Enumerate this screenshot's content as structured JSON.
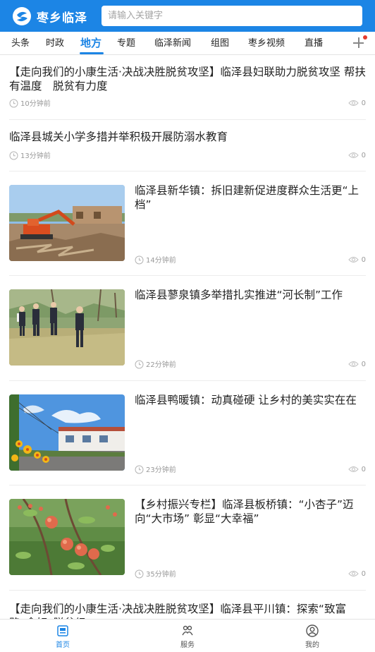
{
  "header": {
    "logo_text": "枣乡临泽",
    "search_placeholder": "请输入关键字",
    "brand_color": "#1c85e5"
  },
  "tabs": [
    {
      "label": "头条"
    },
    {
      "label": "时政"
    },
    {
      "label": "地方",
      "active": true
    },
    {
      "label": "专题"
    },
    {
      "label": "临泽新闻"
    },
    {
      "label": "组图"
    },
    {
      "label": "枣乡视频"
    },
    {
      "label": "直播"
    }
  ],
  "feed": [
    {
      "title": "【走向我们的小康生活·决战决胜脱贫攻坚】临泽县妇联助力脱贫攻坚 帮扶有温度　脱贫有力度",
      "time": "10分钟前",
      "views": "0"
    },
    {
      "title": "临泽县城关小学多措并举积极开展防溺水教育",
      "time": "13分钟前",
      "views": "0"
    },
    {
      "title": "临泽县新华镇：拆旧建新促进度群众生活更“上档”",
      "time": "14分钟前",
      "views": "0",
      "image": "excavator-demolition-photo"
    },
    {
      "title": "临泽县蓼泉镇多举措扎实推进“河长制”工作",
      "time": "22分钟前",
      "views": "0",
      "image": "officials-walking-field-photo"
    },
    {
      "title": "临泽县鸭暖镇：动真碰硬 让乡村的美实实在在",
      "time": "23分钟前",
      "views": "0",
      "image": "village-street-flowers-photo"
    },
    {
      "title": "【乡村振兴专栏】临泽县板桥镇：“小杏子”迈向“大市场” 彰显“大幸福”",
      "time": "35分钟前",
      "views": "0",
      "image": "apricot-tree-photo"
    },
    {
      "title": "【走向我们的小康生活·决战决胜脱贫攻坚】临泽县平川镇：探索“致富路”念好“脱贫经”"
    }
  ],
  "bottom_nav": [
    {
      "label": "首页",
      "icon": "home-icon",
      "active": true
    },
    {
      "label": "服务",
      "icon": "service-icon"
    },
    {
      "label": "我的",
      "icon": "profile-icon"
    }
  ]
}
